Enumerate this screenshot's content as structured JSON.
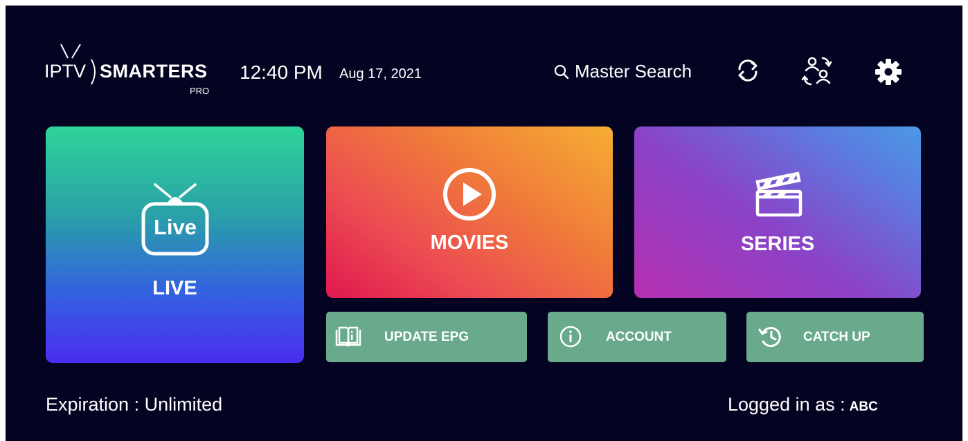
{
  "header": {
    "logo": {
      "brand_left": "IPTV",
      "brand_right": "SMARTERS",
      "sub": "PRO"
    },
    "time": "12:40 PM",
    "date": "Aug 17, 2021",
    "search_label": "Master Search",
    "icons": [
      "search-icon",
      "refresh-icon",
      "switch-user-icon",
      "gear-icon"
    ]
  },
  "tiles": {
    "live": {
      "badge": "Live",
      "label": "LIVE"
    },
    "movies": {
      "label": "MOVIES"
    },
    "series": {
      "label": "SERIES"
    }
  },
  "buttons": {
    "update_epg": "UPDATE EPG",
    "account": "ACCOUNT",
    "catch_up": "CATCH UP"
  },
  "footer": {
    "expiration": "Expiration : Unlimited",
    "logged_in_prefix": "Logged in as :",
    "logged_in_user": "ABC"
  },
  "colors": {
    "background": "#050322",
    "button_green": "#69aa8c"
  }
}
